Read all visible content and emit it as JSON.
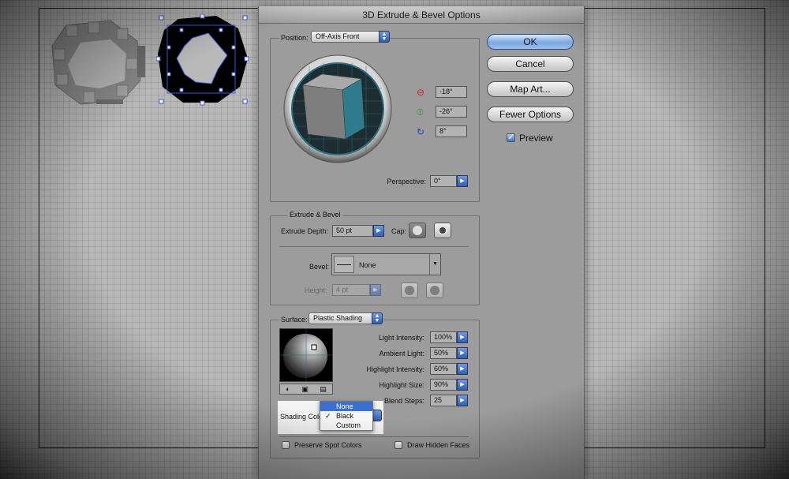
{
  "dialog": {
    "title": "3D Extrude & Bevel Options"
  },
  "position": {
    "label": "Position:",
    "preset": "Off-Axis Front",
    "rot_x": "-18°",
    "rot_y": "-26°",
    "rot_z": "8°",
    "perspective_label": "Perspective:",
    "perspective": "0°"
  },
  "extrude": {
    "group_title": "Extrude & Bevel",
    "depth_label": "Extrude Depth:",
    "depth": "50 pt",
    "cap_label": "Cap:",
    "bevel_label": "Bevel:",
    "bevel": "None",
    "height_label": "Height:",
    "height": "4 pt"
  },
  "surface": {
    "label": "Surface:",
    "type": "Plastic Shading",
    "light_intensity_label": "Light Intensity:",
    "light_intensity": "100%",
    "ambient_light_label": "Ambient Light:",
    "ambient_light": "50%",
    "highlight_intensity_label": "Highlight Intensity:",
    "highlight_intensity": "60%",
    "highlight_size_label": "Highlight Size:",
    "highlight_size": "90%",
    "blend_steps_label": "Blend Steps:",
    "blend_steps": "25",
    "shading_color_label": "Shading Colo",
    "shading_options": [
      "None",
      "Black",
      "Custom"
    ],
    "shading_selected": "Black",
    "shading_highlighted": "None",
    "preserve_spot_label": "Preserve Spot Colors",
    "draw_hidden_label": "Draw Hidden Faces"
  },
  "buttons": {
    "ok": "OK",
    "cancel": "Cancel",
    "map_art": "Map Art...",
    "fewer_options": "Fewer Options",
    "preview": "Preview",
    "preview_checked": true
  },
  "colors": {
    "accent": "#3d6fd1",
    "cube_front": "#2f7a8c",
    "selection": "#3c5bd6"
  }
}
